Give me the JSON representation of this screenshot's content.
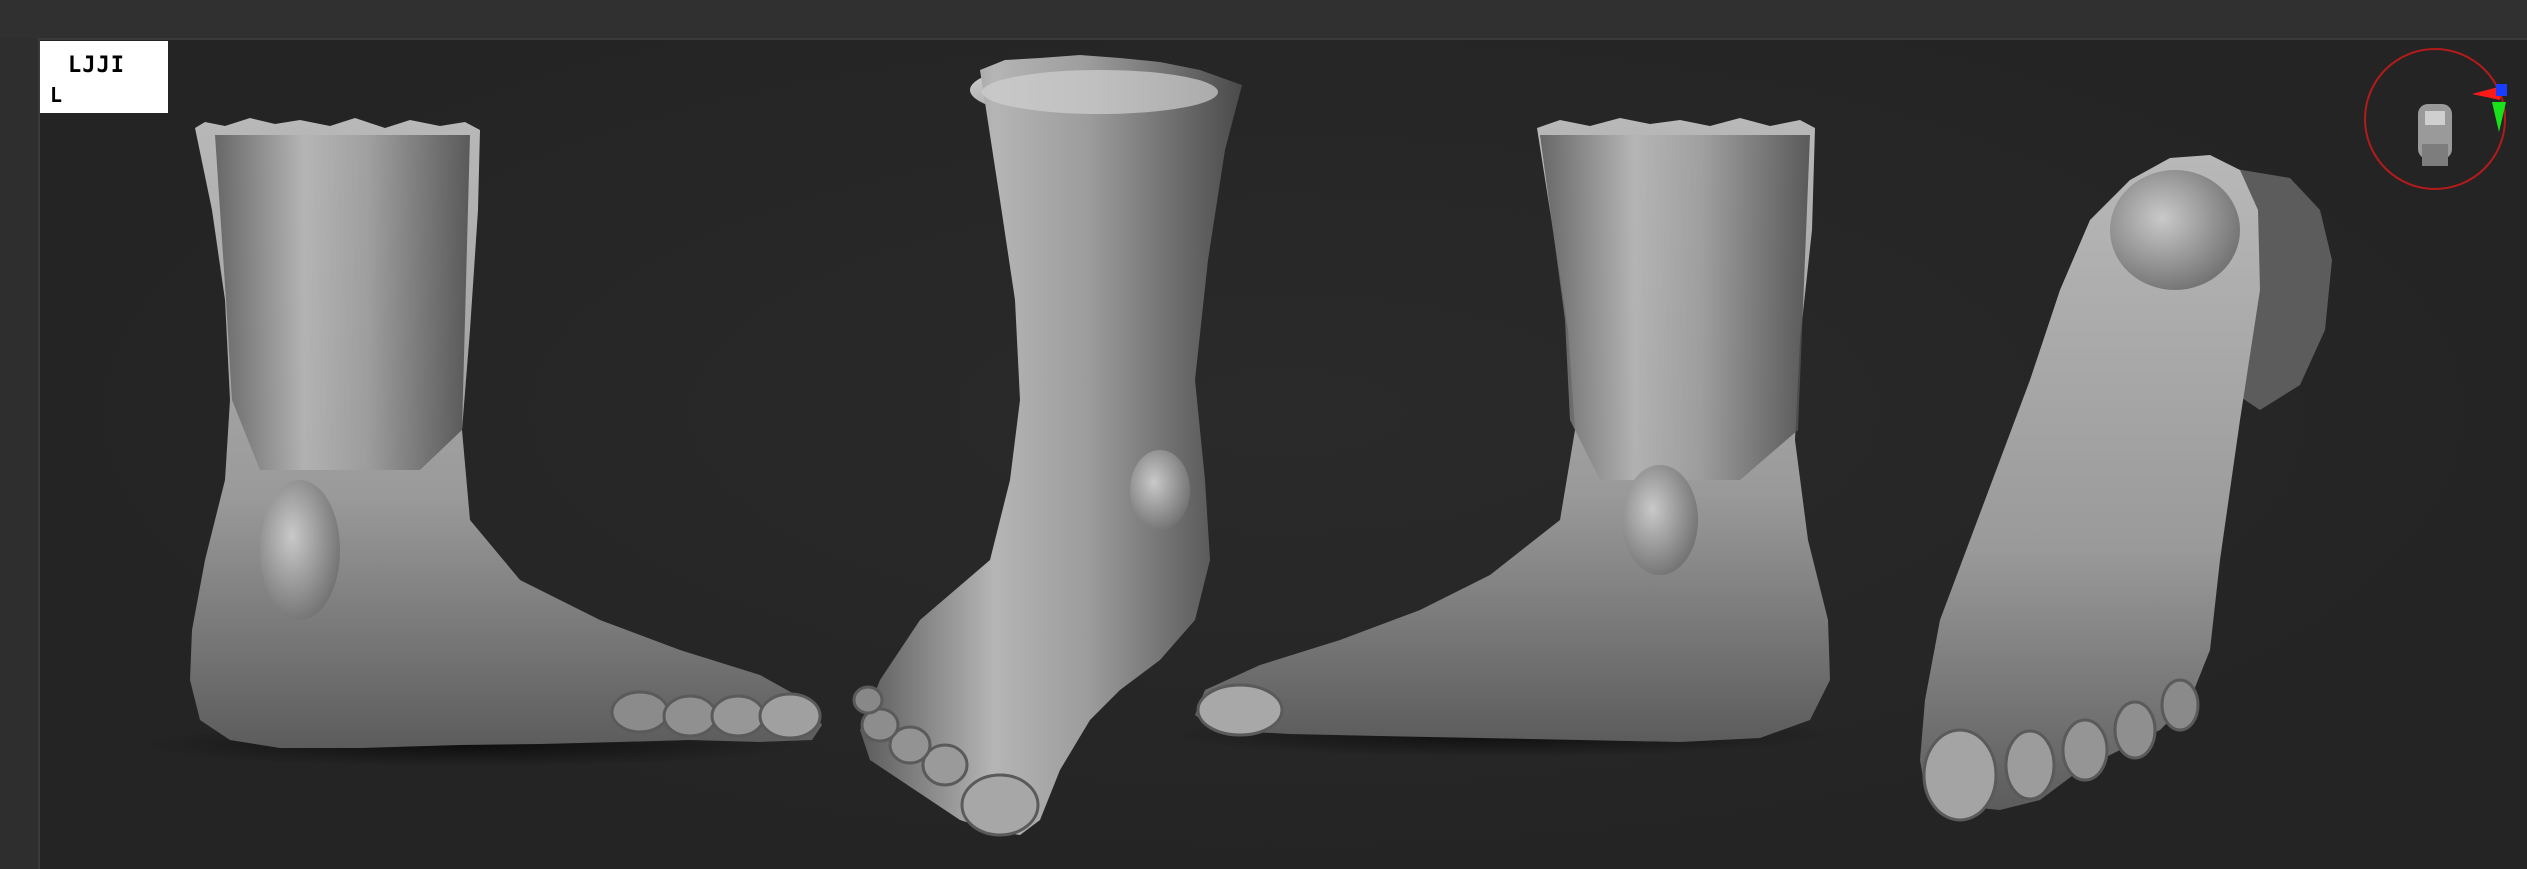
{
  "viewport": {
    "thumbnail_label": "LJJI",
    "thumbnail_sub": "L"
  },
  "gizmo": {
    "icon": "navigation-gizmo-icon",
    "colors": {
      "ring": "#b31b1b",
      "x_axis": "#ff1a1a",
      "y_axis": "#18e21a",
      "z_axis": "#1a3cff"
    }
  },
  "models": [
    {
      "name": "foot-side-left-view",
      "view": "side"
    },
    {
      "name": "foot-three-quarter-front-view",
      "view": "three-quarter"
    },
    {
      "name": "foot-side-right-view",
      "view": "side-mirrored"
    },
    {
      "name": "foot-sole-bottom-view",
      "view": "sole"
    }
  ],
  "colors": {
    "background": "#262626",
    "model": "#9a9a9a"
  }
}
